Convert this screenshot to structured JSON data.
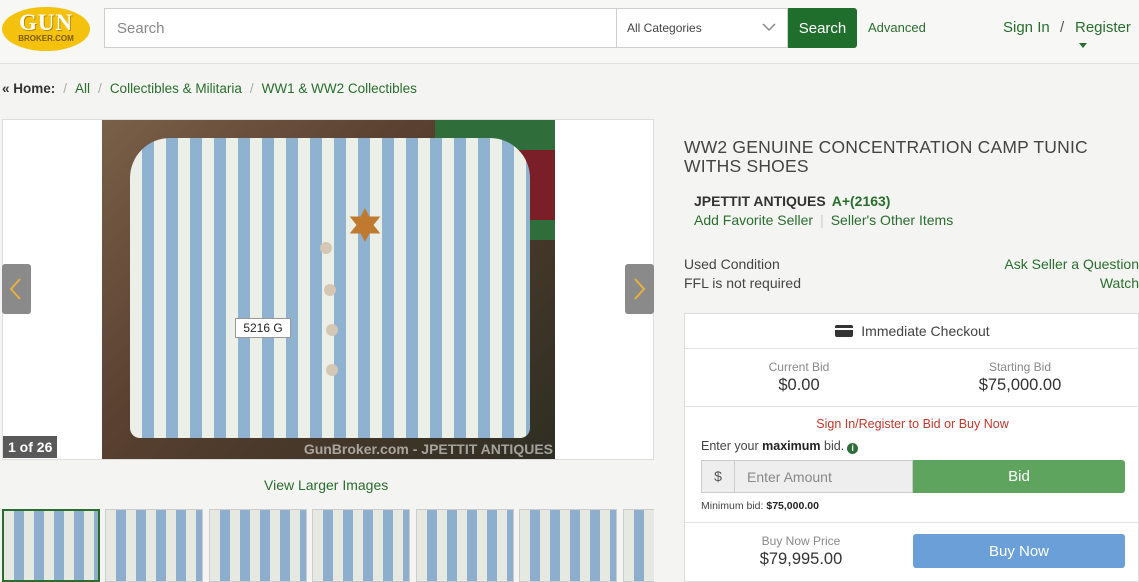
{
  "header": {
    "logo_top": "GUN",
    "logo_bottom": "BROKER.COM",
    "search_placeholder": "Search",
    "category": "All Categories",
    "search_button": "Search",
    "advanced": "Advanced",
    "sign_in": "Sign In",
    "separator": "/",
    "register": "Register"
  },
  "breadcrumb": {
    "home": "« Home:",
    "items": [
      "All",
      "Collectibles & Militaria",
      "WW1 & WW2 Collectibles"
    ]
  },
  "gallery": {
    "counter": "1 of 26",
    "watermark": "GunBroker.com - JPETTIT ANTIQUES",
    "photo_tag": "5216 G",
    "view_larger": "View Larger Images"
  },
  "listing": {
    "title": "WW2 GENUINE CONCENTRATION CAMP TUNIC WITHS SHOES",
    "seller_name": "JPETTIT ANTIQUES",
    "seller_rating": "A+(2163)",
    "add_favorite": "Add Favorite Seller",
    "other_items": "Seller's Other Items",
    "condition_value": "Used",
    "condition_label": "Condition",
    "ffl": "FFL is not required",
    "ask_seller": "Ask Seller a Question",
    "watch": "Watch"
  },
  "purchase": {
    "checkout": "Immediate Checkout",
    "current_bid_label": "Current Bid",
    "current_bid": "$0.00",
    "starting_bid_label": "Starting Bid",
    "starting_bid": "$75,000.00",
    "signin_prompt": "Sign In/Register to Bid or Buy Now",
    "enter_prefix": "Enter your",
    "enter_bold": "maximum",
    "enter_suffix": "bid.",
    "currency": "$",
    "amount_placeholder": "Enter Amount",
    "bid_button": "Bid",
    "min_bid_label": "Minimum bid:",
    "min_bid_value": "$75,000.00",
    "buy_now_label": "Buy Now Price",
    "buy_now_price": "$79,995.00",
    "buy_now_button": "Buy Now"
  }
}
